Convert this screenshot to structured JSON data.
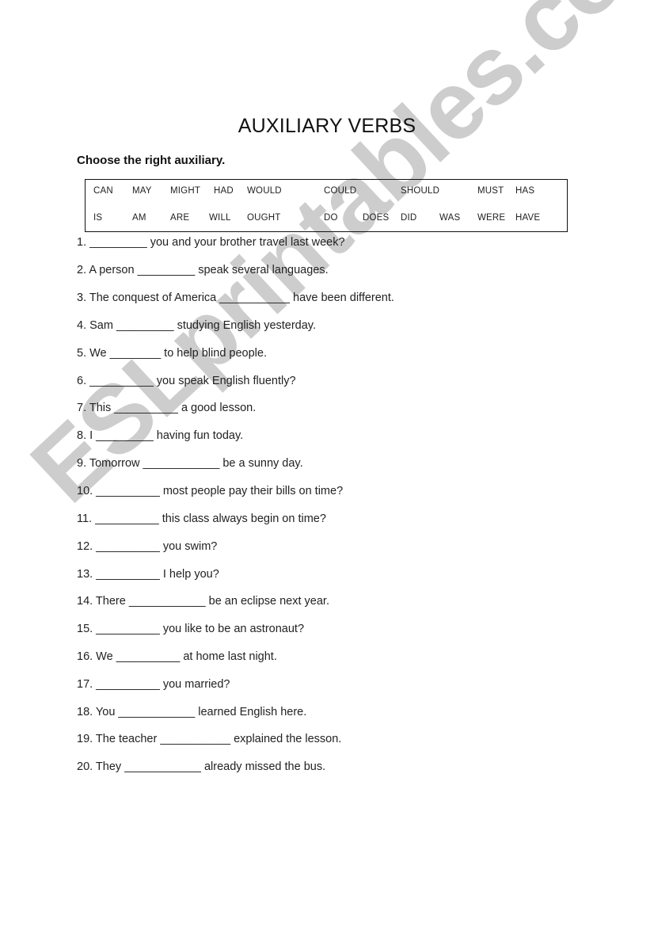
{
  "title": "AUXILIARY VERBS",
  "instruction": "Choose the right auxiliary.",
  "word_bank": {
    "row1": [
      "CAN",
      "MAY",
      "MIGHT",
      "HAD",
      "WOULD",
      "COULD",
      "SHOULD",
      "MUST",
      "HAS"
    ],
    "row2": [
      "IS",
      "AM",
      "ARE",
      "WILL",
      "OUGHT",
      "DO",
      "DOES",
      "DID",
      "WAS",
      "WERE",
      "HAVE"
    ]
  },
  "questions": [
    "1. _________ you and your brother travel last week?",
    "2. A person _________ speak several languages.",
    "3. The conquest of America ___________ have been different.",
    "4. Sam _________ studying English yesterday.",
    "5. We ________ to help blind people.",
    "6. __________ you speak English fluently?",
    "7. This __________ a good lesson.",
    "8. I _________ having fun today.",
    "9. Tomorrow ____________ be a sunny day.",
    "10. __________ most people pay their bills on time?",
    "11. __________ this class always begin on time?",
    "12. __________ you swim?",
    "13. __________ I help you?",
    "14. There ____________ be an eclipse next year.",
    "15. __________ you like to be an astronaut?",
    "16. We __________ at home last night.",
    "17. __________ you married?",
    "18. You ____________ learned English here.",
    "19. The teacher ___________ explained the lesson.",
    "20. They ____________ already missed the bus."
  ],
  "watermark": "ESLprintables.com"
}
